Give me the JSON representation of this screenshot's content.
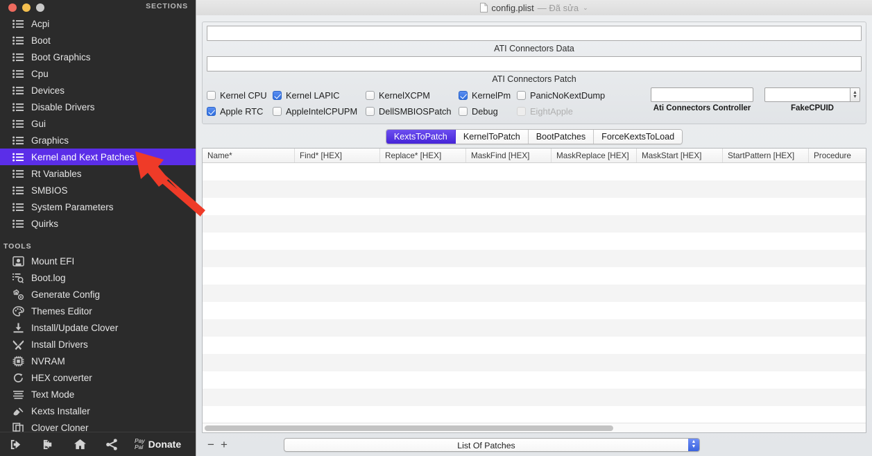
{
  "window": {
    "title_file": "config.plist",
    "title_suffix": "— Đã sửa",
    "chevron": "⌄",
    "traffic": [
      "close",
      "minimize",
      "zoom"
    ]
  },
  "sidebar": {
    "sections_label": "SECTIONS",
    "tools_label": "TOOLS",
    "sections": [
      {
        "label": "Acpi",
        "icon": "list-icon",
        "selected": false
      },
      {
        "label": "Boot",
        "icon": "list-icon",
        "selected": false
      },
      {
        "label": "Boot Graphics",
        "icon": "list-icon",
        "selected": false
      },
      {
        "label": "Cpu",
        "icon": "list-icon",
        "selected": false
      },
      {
        "label": "Devices",
        "icon": "list-icon",
        "selected": false
      },
      {
        "label": "Disable Drivers",
        "icon": "list-icon",
        "selected": false
      },
      {
        "label": "Gui",
        "icon": "list-icon",
        "selected": false
      },
      {
        "label": "Graphics",
        "icon": "list-icon",
        "selected": false
      },
      {
        "label": "Kernel and Kext Patches",
        "icon": "list-icon",
        "selected": true
      },
      {
        "label": "Rt Variables",
        "icon": "list-icon",
        "selected": false
      },
      {
        "label": "SMBIOS",
        "icon": "list-icon",
        "selected": false
      },
      {
        "label": "System Parameters",
        "icon": "list-icon",
        "selected": false
      },
      {
        "label": "Quirks",
        "icon": "list-icon",
        "selected": false
      }
    ],
    "tools": [
      {
        "label": "Mount EFI",
        "icon": "disk-icon"
      },
      {
        "label": "Boot.log",
        "icon": "log-search-icon"
      },
      {
        "label": "Generate Config",
        "icon": "gears-icon"
      },
      {
        "label": "Themes Editor",
        "icon": "palette-icon"
      },
      {
        "label": "Install/Update Clover",
        "icon": "download-icon"
      },
      {
        "label": "Install Drivers",
        "icon": "tools-icon"
      },
      {
        "label": "NVRAM",
        "icon": "chip-icon"
      },
      {
        "label": "HEX converter",
        "icon": "refresh-icon"
      },
      {
        "label": "Text Mode",
        "icon": "text-lines-icon"
      },
      {
        "label": "Kexts Installer",
        "icon": "plug-icon"
      },
      {
        "label": "Clover Cloner",
        "icon": "copy-icon"
      }
    ],
    "bottom_bar": {
      "import_icon": "import-icon",
      "export_icon": "export-icon",
      "home_icon": "home-icon",
      "share_icon": "share-icon",
      "paypal_line1": "Pay",
      "paypal_line2": "Pal",
      "donate_label": "Donate"
    },
    "selected_highlight_color": "#5b2ee8"
  },
  "main": {
    "ati_connectors_data_field": "",
    "ati_connectors_data_label": "ATI Connectors Data",
    "ati_connectors_patch_field": "",
    "ati_connectors_patch_label": "ATI Connectors Patch",
    "checkboxes_row1": [
      {
        "label": "Kernel CPU",
        "checked": false,
        "disabled": false
      },
      {
        "label": "Kernel LAPIC",
        "checked": true,
        "disabled": false
      },
      {
        "label": "KernelXCPM",
        "checked": false,
        "disabled": false
      },
      {
        "label": "KernelPm",
        "checked": true,
        "disabled": false
      },
      {
        "label": "PanicNoKextDump",
        "checked": false,
        "disabled": false
      }
    ],
    "checkboxes_row2": [
      {
        "label": "Apple RTC",
        "checked": true,
        "disabled": false
      },
      {
        "label": "AppleIntelCPUPM",
        "checked": false,
        "disabled": false
      },
      {
        "label": "DellSMBIOSPatch",
        "checked": false,
        "disabled": false
      },
      {
        "label": "Debug",
        "checked": false,
        "disabled": false
      },
      {
        "label": "EightApple",
        "checked": false,
        "disabled": true
      }
    ],
    "ati_controller": {
      "value": "",
      "label": "Ati Connectors Controller"
    },
    "fake_cpuid": {
      "value": "",
      "label": "FakeCPUID"
    },
    "tabs": [
      {
        "label": "KextsToPatch",
        "active": true
      },
      {
        "label": "KernelToPatch",
        "active": false
      },
      {
        "label": "BootPatches",
        "active": false
      },
      {
        "label": "ForceKextsToLoad",
        "active": false
      }
    ],
    "table": {
      "columns": [
        {
          "label": "Name*",
          "width": 133
        },
        {
          "label": "Find* [HEX]",
          "width": 123
        },
        {
          "label": "Replace* [HEX]",
          "width": 124
        },
        {
          "label": "MaskFind [HEX]",
          "width": 123
        },
        {
          "label": "MaskReplace [HEX]",
          "width": 123
        },
        {
          "label": "MaskStart [HEX]",
          "width": 124
        },
        {
          "label": "StartPattern [HEX]",
          "width": 124
        },
        {
          "label": "Procedure",
          "width": 80
        }
      ],
      "rows": [],
      "empty_row_count": 15
    },
    "footer": {
      "remove_label": "−",
      "add_label": "+",
      "popup_value": "List Of Patches"
    },
    "accent_color": "#4524d8"
  },
  "annotation": {
    "arrow_color": "#ef3b28",
    "points_to": "Kernel and Kext Patches"
  }
}
